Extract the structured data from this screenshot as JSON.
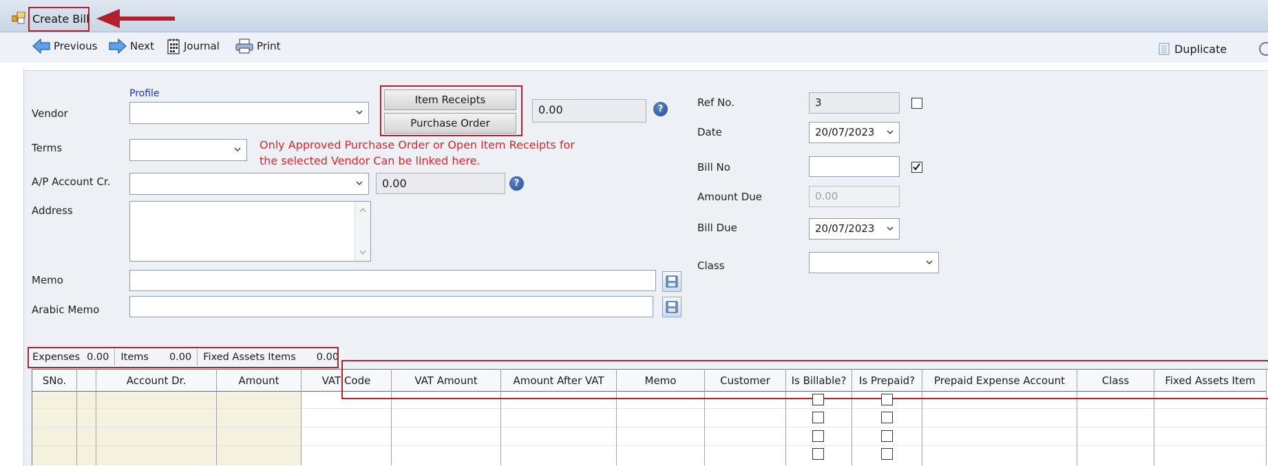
{
  "window": {
    "title": "Create Bill"
  },
  "toolbar": {
    "previous": "Previous",
    "next": "Next",
    "journal": "Journal",
    "print": "Print",
    "duplicate": "Duplicate"
  },
  "form": {
    "profile_link": "Profile",
    "vendor_label": "Vendor",
    "vendor_value": "",
    "vendor_balance": "0.00",
    "item_receipts_button": "Item Receipts",
    "purchase_order_button": "Purchase Order",
    "terms_label": "Terms",
    "terms_value": "",
    "note": [
      "Only Approved Purchase Order or Open Item Receipts for",
      "the selected Vendor Can be linked here."
    ],
    "ap_account_label": "A/P Account Cr.",
    "ap_account_value": "",
    "ap_balance": "0.00",
    "address_label": "Address",
    "memo_label": "Memo",
    "arabic_memo_label": "Arabic Memo",
    "ref_no_label": "Ref No.",
    "ref_no_value": "3",
    "date_label": "Date",
    "date_value": "20/07/2023",
    "bill_no_label": "Bill No",
    "bill_no_value": "",
    "amount_due_label": "Amount Due",
    "amount_due_value": "0.00",
    "bill_due_label": "Bill Due",
    "bill_due_value": "20/07/2023",
    "class_label": "Class",
    "class_value": ""
  },
  "summary": {
    "expenses_label": "Expenses",
    "expenses_value": "0.00",
    "items_label": "Items",
    "items_value": "0.00",
    "fixed_assets_label": "Fixed Assets Items",
    "fixed_assets_value": "0.00"
  },
  "grid": {
    "columns": [
      "SNo.",
      "",
      "Account Dr.",
      "Amount",
      "VAT Code",
      "VAT Amount",
      "Amount After VAT",
      "Memo",
      "Customer",
      "Is Billable?",
      "Is Prepaid?",
      "Prepaid Expense Account",
      "Class",
      "Fixed Assets Item"
    ]
  },
  "colors": {
    "highlight_red": "#b0212b",
    "link_blue": "#1c2fd0",
    "note_red": "#e0242c"
  },
  "icons": [
    "app-window-icon",
    "arrow-left-icon",
    "arrow-right-icon",
    "journal-icon",
    "printer-icon",
    "duplicate-icon",
    "help-icon",
    "chevron-down-icon",
    "save-disk-icon"
  ]
}
